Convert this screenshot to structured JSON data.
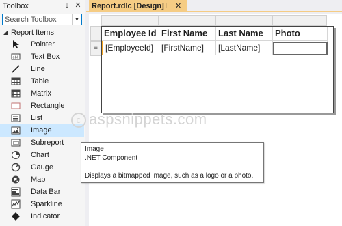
{
  "toolbox": {
    "title": "Toolbox",
    "pin_glyph": "↓",
    "close_glyph": "✕",
    "search_placeholder": "Search Toolbox",
    "group_label": "Report Items",
    "items": [
      {
        "label": "Pointer",
        "icon": "pointer-icon"
      },
      {
        "label": "Text Box",
        "icon": "textbox-icon"
      },
      {
        "label": "Line",
        "icon": "line-icon"
      },
      {
        "label": "Table",
        "icon": "table-icon"
      },
      {
        "label": "Matrix",
        "icon": "matrix-icon"
      },
      {
        "label": "Rectangle",
        "icon": "rectangle-icon"
      },
      {
        "label": "List",
        "icon": "list-icon"
      },
      {
        "label": "Image",
        "icon": "image-icon"
      },
      {
        "label": "Subreport",
        "icon": "subreport-icon"
      },
      {
        "label": "Chart",
        "icon": "chart-icon"
      },
      {
        "label": "Gauge",
        "icon": "gauge-icon"
      },
      {
        "label": "Map",
        "icon": "map-icon"
      },
      {
        "label": "Data Bar",
        "icon": "databar-icon"
      },
      {
        "label": "Sparkline",
        "icon": "sparkline-icon"
      },
      {
        "label": "Indicator",
        "icon": "indicator-icon"
      }
    ],
    "selected_item": "Image"
  },
  "document": {
    "tab_label": "Report.rdlc [Design]",
    "tab_pin_glyph": "⊥",
    "tab_close_glyph": "✕",
    "accent_color": "#f5cc84"
  },
  "table": {
    "headers": [
      "Employee Id",
      "First Name",
      "Last Name",
      "Photo"
    ],
    "row": [
      "[EmployeeId]",
      "[FirstName]",
      "[LastName]",
      ""
    ],
    "row_handle_glyph": "≡"
  },
  "tooltip": {
    "title": "Image",
    "subtitle": ".NET Component",
    "description": "Displays a bitmapped image, such as a logo or a photo."
  },
  "watermark": {
    "text": "aspsnippets.com",
    "symbol": "c"
  }
}
